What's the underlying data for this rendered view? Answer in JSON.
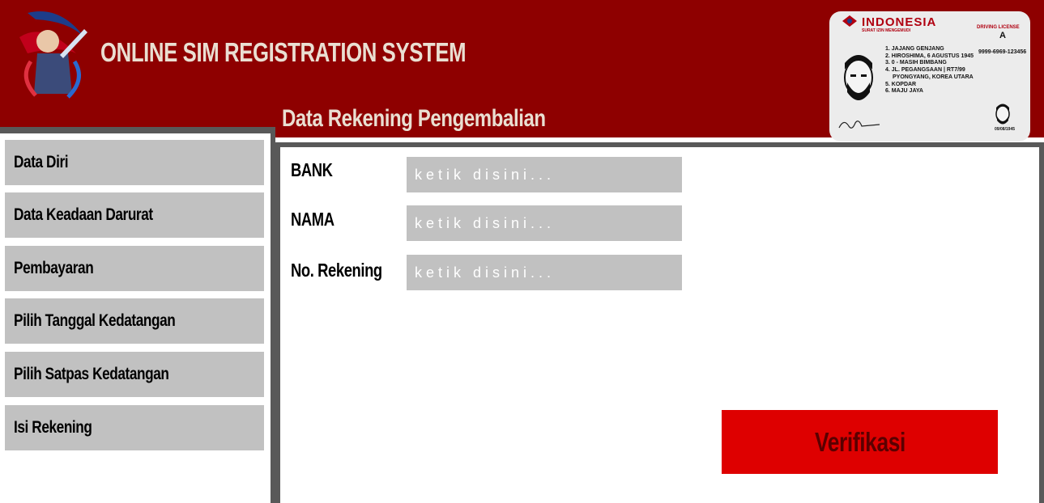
{
  "header": {
    "app_title": "ONLINE SIM REGISTRATION SYSTEM",
    "section_title": "Data Rekening Pengembalian",
    "logo_icon": "archer-logo-icon"
  },
  "sim_card": {
    "country": "INDONESIA",
    "subtitle": "SURAT IZIN MENGEMUDI",
    "license_label": "DRIVING LICENSE",
    "class": "A",
    "number": "9999-6969-123456",
    "lines": [
      "1. JAJANG GENJANG",
      "2. HIROSHIMA, 6 AGUSTUS 1945",
      "3. 0 - MASIH BIMBANG",
      "4. JL. PEGANGSAAN | RT7/99",
      "PYONGYANG, KOREA UTARA",
      "5. KOPDAR",
      "6. MAJU JAYA"
    ],
    "date": "09/08/1945"
  },
  "sidebar": {
    "items": [
      {
        "label": "Data Diri"
      },
      {
        "label": "Data Keadaan Darurat"
      },
      {
        "label": "Pembayaran"
      },
      {
        "label": "Pilih Tanggal Kedatangan"
      },
      {
        "label": "Pilih Satpas Kedatangan"
      },
      {
        "label": "Isi Rekening"
      }
    ]
  },
  "form": {
    "fields": [
      {
        "label": "BANK",
        "value": "",
        "placeholder": "ketik disini..."
      },
      {
        "label": "NAMA",
        "value": "",
        "placeholder": "ketik disini..."
      },
      {
        "label": "No. Rekening",
        "value": "",
        "placeholder": "ketik disini..."
      }
    ],
    "submit_label": "Verifikasi"
  },
  "colors": {
    "header_bg": "#8e0000",
    "button_bg": "#de0000",
    "menu_bg": "#c1c1c1",
    "frame_border": "#595959"
  }
}
